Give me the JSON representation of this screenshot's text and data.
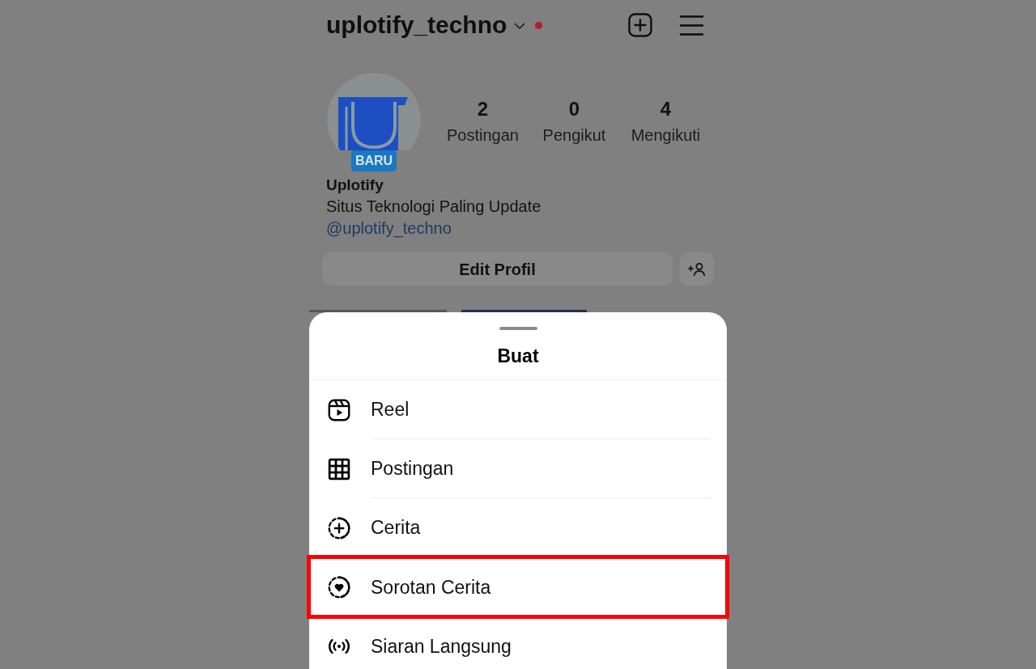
{
  "header": {
    "username": "uplotify_techno",
    "has_notification": true
  },
  "profile": {
    "avatar_badge": "BARU",
    "stats": [
      {
        "value": "2",
        "label": "Postingan"
      },
      {
        "value": "0",
        "label": "Pengikut"
      },
      {
        "value": "4",
        "label": "Mengikuti"
      }
    ],
    "name": "Uplotify",
    "bio": "Situs Teknologi Paling Update",
    "link": "@uplotify_techno",
    "edit_button": "Edit Profil"
  },
  "sheet": {
    "title": "Buat",
    "items": [
      {
        "kind": "reel",
        "label": "Reel",
        "highlighted": false
      },
      {
        "kind": "post",
        "label": "Postingan",
        "highlighted": false
      },
      {
        "kind": "story",
        "label": "Cerita",
        "highlighted": false
      },
      {
        "kind": "highlight",
        "label": "Sorotan Cerita",
        "highlighted": true
      },
      {
        "kind": "live",
        "label": "Siaran Langsung",
        "highlighted": false
      }
    ]
  }
}
